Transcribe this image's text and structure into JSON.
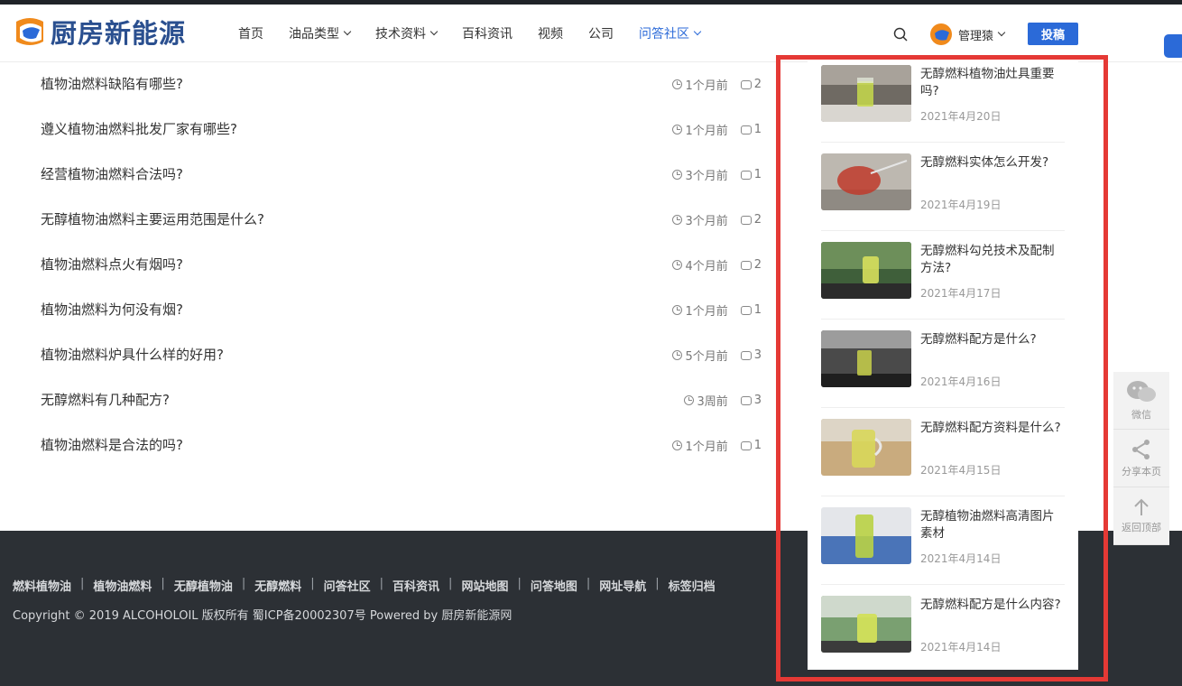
{
  "header": {
    "logo_text": "厨房新能源",
    "nav": [
      {
        "label": "首页",
        "has_dropdown": false,
        "active": false
      },
      {
        "label": "油品类型",
        "has_dropdown": true,
        "active": false
      },
      {
        "label": "技术资料",
        "has_dropdown": true,
        "active": false
      },
      {
        "label": "百科资讯",
        "has_dropdown": false,
        "active": false
      },
      {
        "label": "视频",
        "has_dropdown": false,
        "active": false
      },
      {
        "label": "公司",
        "has_dropdown": false,
        "active": false
      },
      {
        "label": "问答社区",
        "has_dropdown": true,
        "active": true
      }
    ],
    "user_name": "管理猿",
    "submit_label": "投稿"
  },
  "questions": [
    {
      "title": "植物油燃料缺陷有哪些?",
      "time": "1个月前",
      "comments": "2"
    },
    {
      "title": "遵义植物油燃料批发厂家有哪些?",
      "time": "1个月前",
      "comments": "1"
    },
    {
      "title": "经营植物油燃料合法吗?",
      "time": "3个月前",
      "comments": "1"
    },
    {
      "title": "无醇植物油燃料主要运用范围是什么?",
      "time": "3个月前",
      "comments": "2"
    },
    {
      "title": "植物油燃料点火有烟吗?",
      "time": "4个月前",
      "comments": "2"
    },
    {
      "title": "植物油燃料为何没有烟?",
      "time": "1个月前",
      "comments": "1"
    },
    {
      "title": "植物油燃料炉具什么样的好用?",
      "time": "5个月前",
      "comments": "3"
    },
    {
      "title": "无醇燃料有几种配方?",
      "time": "3周前",
      "comments": "3"
    },
    {
      "title": "植物油燃料是合法的吗?",
      "time": "1个月前",
      "comments": "1"
    }
  ],
  "sidebar_articles": [
    {
      "title": "无醇燃料植物油灶具重要吗?",
      "date": "2021年4月20日"
    },
    {
      "title": "无醇燃料实体怎么开发?",
      "date": "2021年4月19日"
    },
    {
      "title": "无醇燃料勾兑技术及配制方法?",
      "date": "2021年4月17日"
    },
    {
      "title": "无醇燃料配方是什么?",
      "date": "2021年4月16日"
    },
    {
      "title": "无醇燃料配方资料是什么?",
      "date": "2021年4月15日"
    },
    {
      "title": "无醇植物油燃料高清图片素材",
      "date": "2021年4月14日"
    },
    {
      "title": "无醇燃料配方是什么内容?",
      "date": "2021年4月14日"
    }
  ],
  "footer": {
    "links": [
      "燃料植物油",
      "植物油燃料",
      "无醇植物油",
      "无醇燃料",
      "问答社区",
      "百科资讯",
      "网站地图",
      "问答地图",
      "网址导航",
      "标签归档"
    ],
    "copyright": "Copyright © 2019 ALCOHOLOIL 版权所有 蜀ICP备20002307号 Powered by 厨房新能源网"
  },
  "float_tools": [
    {
      "label": "微信",
      "icon": "wechat-icon"
    },
    {
      "label": "分享本页",
      "icon": "share-icon"
    },
    {
      "label": "返回顶部",
      "icon": "arrow-up-icon"
    }
  ],
  "colors": {
    "accent": "#2b6ad8",
    "highlight": "#e53935",
    "footer_bg": "#2c3035"
  }
}
